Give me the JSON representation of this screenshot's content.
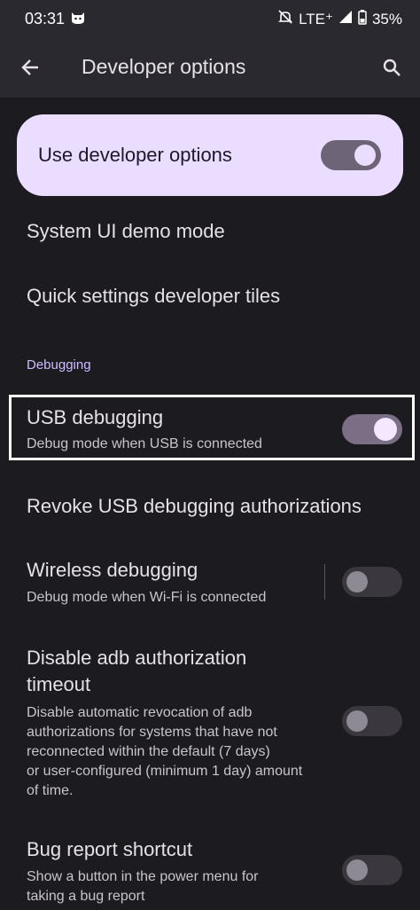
{
  "status_bar": {
    "time": "03:31",
    "network": "LTE⁺",
    "battery": "35%"
  },
  "app_bar": {
    "title": "Developer options"
  },
  "master_toggle": {
    "label": "Use developer options",
    "enabled": true
  },
  "items": [
    {
      "title": "System UI demo mode"
    },
    {
      "title": "Quick settings developer tiles"
    }
  ],
  "section": {
    "debugging": "Debugging"
  },
  "usb_debugging": {
    "title": "USB debugging",
    "subtitle": "Debug mode when USB is connected",
    "enabled": true
  },
  "revoke": {
    "title": "Revoke USB debugging authorizations"
  },
  "wireless_debugging": {
    "title": "Wireless debugging",
    "subtitle": "Debug mode when Wi-Fi is connected",
    "enabled": false
  },
  "adb_timeout": {
    "title_line1": "Disable adb authorization",
    "title_line2": "timeout",
    "subtitle_lines": [
      "Disable automatic revocation of adb",
      "authorizations for systems that have not",
      "reconnected within the default (7 days)",
      "or user-configured (minimum 1 day) amount",
      "of time."
    ],
    "enabled": false
  },
  "bug_report": {
    "title": "Bug report shortcut",
    "subtitle_lines": [
      "Show a button in the power menu for",
      "taking a bug report"
    ],
    "enabled": false
  }
}
